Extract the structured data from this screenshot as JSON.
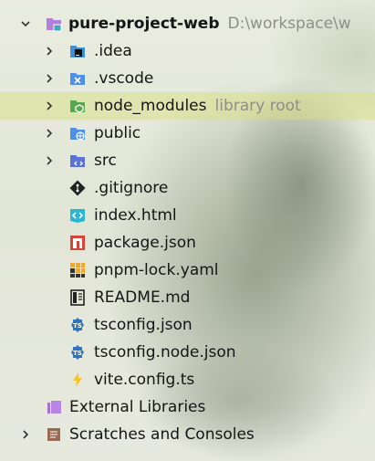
{
  "project": {
    "name": "pure-project-web",
    "path": "D:\\workspace\\w"
  },
  "items": [
    {
      "label": "idea",
      "display": ".idea",
      "icon": "idea-folder-icon"
    },
    {
      "label": ".vscode",
      "icon": "vscode-folder-icon"
    },
    {
      "label": "node_modules",
      "hint": "library root",
      "icon": "node-modules-folder-icon"
    },
    {
      "label": "public",
      "icon": "public-folder-icon"
    },
    {
      "label": "src",
      "icon": "src-folder-icon"
    },
    {
      "label": ".gitignore",
      "icon": "git-icon"
    },
    {
      "label": "index.html",
      "icon": "html-file-icon"
    },
    {
      "label": "package.json",
      "icon": "npm-file-icon"
    },
    {
      "label": "pnpm-lock.yaml",
      "icon": "pnpm-file-icon"
    },
    {
      "label": "README.md",
      "icon": "markdown-file-icon"
    },
    {
      "label": "tsconfig.json",
      "icon": "ts-config-icon"
    },
    {
      "label": "tsconfig.node.json",
      "icon": "ts-config-icon"
    },
    {
      "label": "vite.config.ts",
      "icon": "vite-icon"
    }
  ],
  "external_libraries": {
    "label": "External Libraries",
    "icon": "external-libraries-icon"
  },
  "scratches": {
    "label": "Scratches and Consoles",
    "icon": "scratches-icon"
  },
  "colors": {
    "folder_blue": "#4e8fe8",
    "folder_purple": "#a66fd8",
    "folder_green": "#5aa84e",
    "highlight": "#d6e178"
  }
}
